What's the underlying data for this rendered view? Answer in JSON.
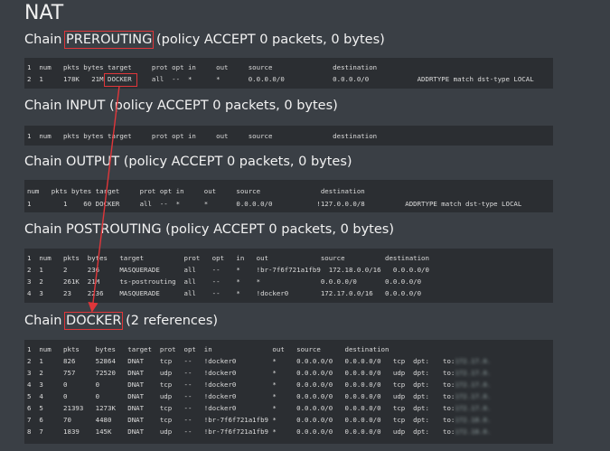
{
  "page_title": "NAT",
  "sections": {
    "prerouting": {
      "heading_prefix": "Chain ",
      "heading_name": "PREROUTING",
      "heading_suffix": " (policy ACCEPT 0 packets, 0 bytes)",
      "lines": [
        "1  num   pkts bytes target     prot opt in     out     source               destination",
        "2  1     178K   21M DOCKER     all  --  *      *       0.0.0.0/0            0.0.0.0/0            ADDRTYPE match dst-type LOCAL"
      ]
    },
    "input": {
      "heading": "Chain INPUT (policy ACCEPT 0 packets, 0 bytes)",
      "lines": [
        "1  num   pkts bytes target     prot opt in     out     source               destination"
      ]
    },
    "output": {
      "heading": "Chain OUTPUT (policy ACCEPT 0 packets, 0 bytes)",
      "lines": [
        "num   pkts bytes target     prot opt in     out     source               destination",
        "1        1    60 DOCKER     all  --  *      *       0.0.0.0/0           !127.0.0.0/8          ADDRTYPE match dst-type LOCAL"
      ]
    },
    "postrouting": {
      "heading": "Chain POSTROUTING (policy ACCEPT 0 packets, 0 bytes)",
      "lines": [
        "1  num   pkts  bytes   target          prot   opt   in   out             source          destination",
        "2  1     2     236     MASQUERADE      all    --    *    !br-7f6f721a1fb9  172.18.0.0/16   0.0.0.0/0",
        "3  2     261K  21M     ts-postrouting  all    --    *    *               0.0.0.0/0       0.0.0.0/0",
        "4  3     23    2236    MASQUERADE      all    --    *    !docker0        172.17.0.0/16   0.0.0.0/0"
      ]
    },
    "docker": {
      "heading_prefix": "Chain ",
      "heading_name": "DOCKER",
      "heading_suffix": " (2 references)",
      "lines": [
        "1  num   pkts    bytes   target  prot  opt  in               out   source      destination",
        "2  1     826     52864   DNAT    tcp   --   !docker0         *     0.0.0.0/0   0.0.0.0/0   tcp  dpt:",
        "3  2     757     72520   DNAT    udp   --   !docker0         *     0.0.0.0/0   0.0.0.0/0   udp  dpt:",
        "4  3     0       0       DNAT    tcp   --   !docker0         *     0.0.0.0/0   0.0.0.0/0   tcp  dpt:",
        "5  4     0       0       DNAT    udp   --   !docker0         *     0.0.0.0/0   0.0.0.0/0   udp  dpt:",
        "6  5     21393   1273K   DNAT    tcp   --   !docker0         *     0.0.0.0/0   0.0.0.0/0   tcp  dpt:",
        "7  6     70      4480    DNAT    tcp   --   !br-7f6f721a1fb9 *     0.0.0.0/0   0.0.0.0/0   tcp  dpt:",
        "8  7     1839    145K    DNAT    udp   --   !br-7f6f721a1fb9 *     0.0.0.0/0   0.0.0.0/0   udp  dpt:"
      ],
      "to_prefix": "to:",
      "to_values": [
        "172.17.0.",
        "172.17.0.",
        "172.17.0.",
        "172.17.0.",
        "172.17.0.",
        "172.18.0.",
        "172.18.0."
      ]
    }
  },
  "colors": {
    "background": "#3a3f45",
    "code_bg": "#2b2e32",
    "highlight": "#e0363a"
  }
}
